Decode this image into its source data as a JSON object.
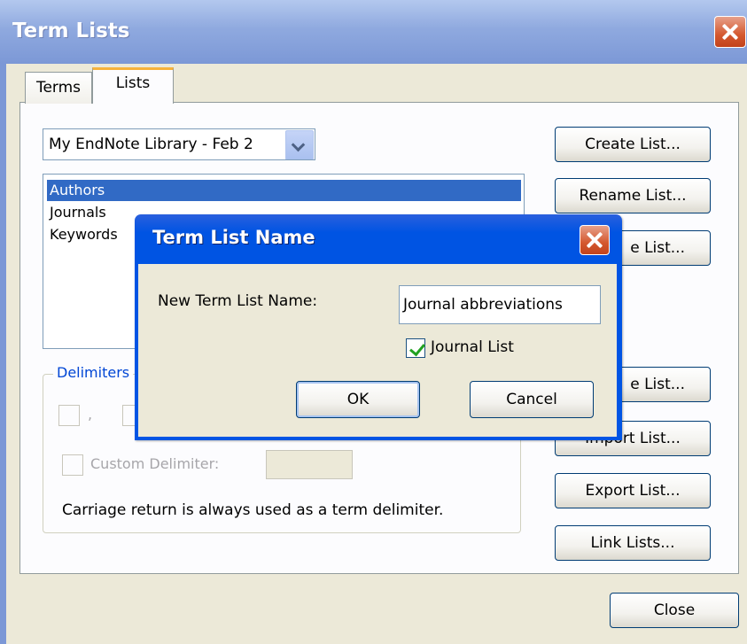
{
  "window": {
    "title": "Term Lists"
  },
  "tabs": [
    {
      "label": "Terms"
    },
    {
      "label": "Lists"
    }
  ],
  "library_select": {
    "value": "My EndNote Library - Feb 2"
  },
  "term_lists": [
    {
      "label": "Authors",
      "selected": true
    },
    {
      "label": "Journals",
      "selected": false
    },
    {
      "label": "Keywords",
      "selected": false
    }
  ],
  "side_buttons": {
    "create": "Create List...",
    "rename": "Rename List...",
    "delete_partial": "e List...",
    "update_partial": "e List...",
    "import_partial": "Import List...",
    "export": "Export List...",
    "link": "Link Lists..."
  },
  "delimiters": {
    "legend": "Delimiters",
    "comma_label": ",",
    "custom_label": "Custom Delimiter:",
    "custom_value": "",
    "note": "Carriage return is always used as a term delimiter."
  },
  "close_button": "Close",
  "dialog": {
    "title": "Term List Name",
    "name_label": "New Term List Name:",
    "name_value": "Journal abbreviations",
    "journal_checkbox_label": "Journal List",
    "journal_checked": true,
    "ok": "OK",
    "cancel": "Cancel"
  },
  "colors": {
    "selection": "#316ac5",
    "dialog_titlebar": "#0054e3",
    "window_titlebar": "#8fa9df",
    "group_legend": "#0046d5"
  }
}
